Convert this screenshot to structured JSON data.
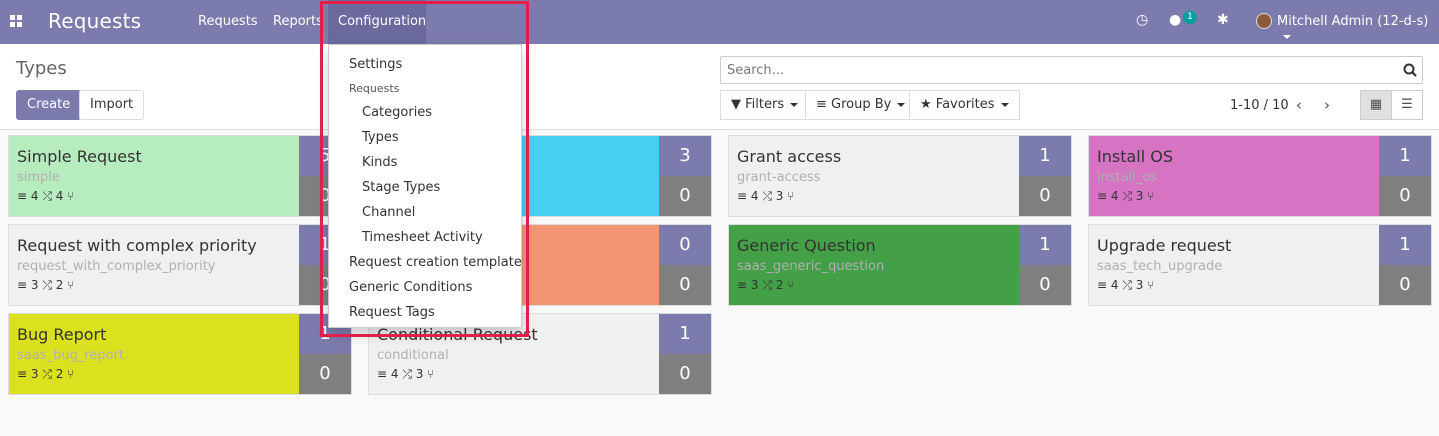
{
  "topbar": {
    "brand": "Requests",
    "menus": [
      "Requests",
      "Reports",
      "Configuration"
    ],
    "badge": "1",
    "user": "Mitchell Admin (12-d-s)"
  },
  "control_panel": {
    "breadcrumb": "Types",
    "create_label": "Create",
    "import_label": "Import",
    "search_placeholder": "Search...",
    "filters_label": "Filters",
    "groupby_label": "Group By",
    "favorites_label": "Favorites",
    "pager": "1-10 / 10"
  },
  "dropdown": {
    "items": [
      {
        "label": "Settings"
      },
      {
        "label": "Requests"
      },
      {
        "label": "Categories"
      },
      {
        "label": "Types"
      },
      {
        "label": "Kinds"
      },
      {
        "label": "Stage Types"
      },
      {
        "label": "Channel"
      },
      {
        "label": "Timesheet Activity"
      },
      {
        "label": "Request creation template"
      },
      {
        "label": "Generic Conditions"
      },
      {
        "label": "Request Tags"
      }
    ]
  },
  "cards": [
    {
      "title": "Simple Request",
      "code": "simple",
      "stats": "≡ 4  ⤮ 4  ⑂",
      "num1": "5",
      "num2": "0",
      "color": "#b7ecbe"
    },
    {
      "title": "",
      "code": "",
      "stats": "",
      "num1": "3",
      "num2": "0",
      "color": "#45cff0"
    },
    {
      "title": "Grant access",
      "code": "grant-access",
      "stats": "≡ 4  ⤮ 3  ⑂",
      "num1": "1",
      "num2": "0",
      "color": "#f0f0f0"
    },
    {
      "title": "Install OS",
      "code": "install_os",
      "stats": "≡ 4  ⤮ 3  ⑂",
      "num1": "1",
      "num2": "0",
      "color": "#d674c3"
    },
    {
      "title": "Request with complex priority",
      "code": "request_with_complex_priority",
      "stats": "≡ 3  ⤮ 2  ⑂",
      "num1": "1",
      "num2": "0",
      "color": "#f0f0f0"
    },
    {
      "title": "",
      "code": "",
      "stats": "",
      "num1": "0",
      "num2": "0",
      "color": "#f19574"
    },
    {
      "title": "Generic Question",
      "code": "saas_generic_question",
      "stats": "≡ 3  ⤮ 2  ⑂",
      "num1": "1",
      "num2": "0",
      "color": "#44a046"
    },
    {
      "title": "Upgrade request",
      "code": "saas_tech_upgrade",
      "stats": "≡ 4  ⤮ 3  ⑂",
      "num1": "1",
      "num2": "0",
      "color": "#f0f0f0"
    },
    {
      "title": "Bug Report",
      "code": "saas_bug_report",
      "stats": "≡ 3  ⤮ 2  ⑂",
      "num1": "1",
      "num2": "0",
      "color": "#dbe01f"
    },
    {
      "title": "Conditional Request",
      "code": "conditional",
      "stats": "≡ 4  ⤮ 3  ⑂",
      "num1": "1",
      "num2": "0",
      "color": "#f0f0f0"
    }
  ]
}
